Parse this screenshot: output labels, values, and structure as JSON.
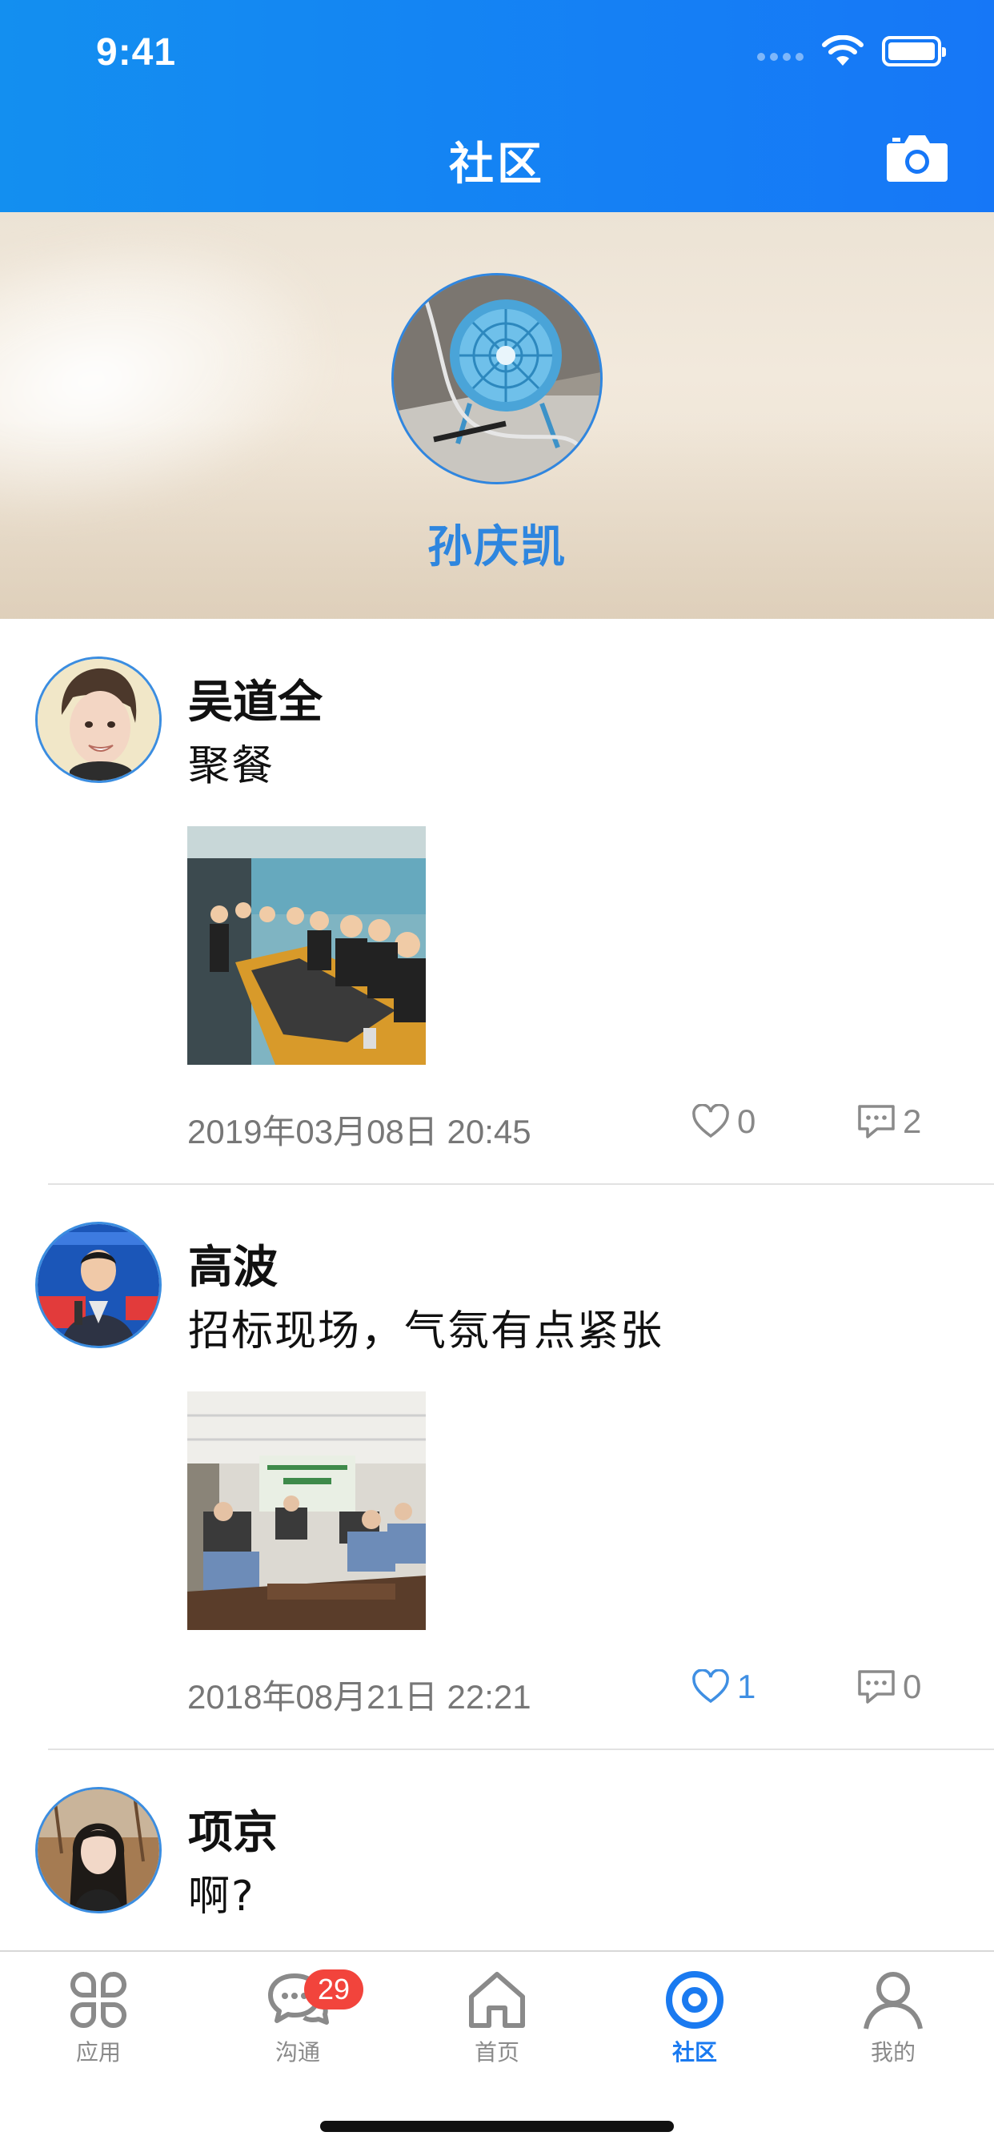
{
  "status_bar": {
    "time": "9:41"
  },
  "header": {
    "title": "社区",
    "camera_icon": "camera-icon",
    "background": "#1677f7"
  },
  "banner": {
    "user_name": "孙庆凯",
    "name_color": "#2e86df"
  },
  "posts": [
    {
      "author": "吴道全",
      "text": "聚餐",
      "time": "2019年03月08日 20:45",
      "likes": "0",
      "comments": "2",
      "liked": false
    },
    {
      "author": "高波",
      "text": "招标现场，气氛有点紧张",
      "time": "2018年08月21日 22:21",
      "likes": "1",
      "comments": "0",
      "liked": true
    },
    {
      "author": "项京",
      "text": "啊?"
    }
  ],
  "tabbar": {
    "items": [
      {
        "label": "应用",
        "icon": "apps-icon"
      },
      {
        "label": "沟通",
        "icon": "chat-icon",
        "badge": "29"
      },
      {
        "label": "首页",
        "icon": "home-icon"
      },
      {
        "label": "社区",
        "icon": "community-icon",
        "active": true
      },
      {
        "label": "我的",
        "icon": "profile-icon"
      }
    ],
    "active_color": "#1a7af0",
    "badge_color": "#f2443c"
  }
}
